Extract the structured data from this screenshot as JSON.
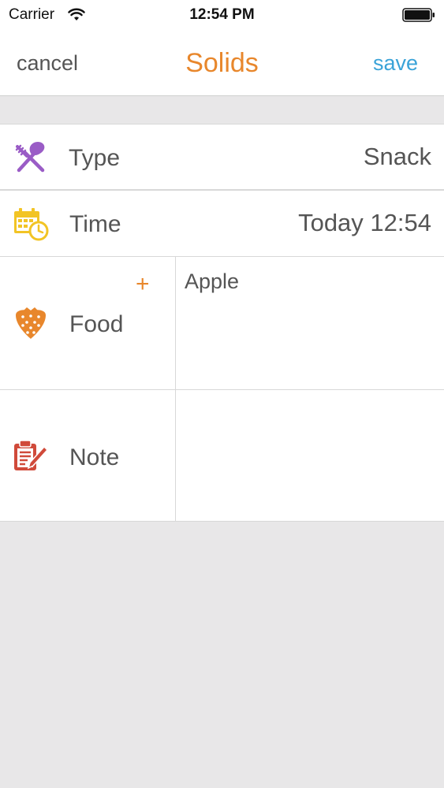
{
  "status_bar": {
    "carrier": "Carrier",
    "time": "12:54 PM"
  },
  "nav": {
    "cancel_label": "cancel",
    "title": "Solids",
    "save_label": "save"
  },
  "form": {
    "type": {
      "label": "Type",
      "value": "Snack",
      "icon": "fork-spoon-icon"
    },
    "time": {
      "label": "Time",
      "value": "Today 12:54",
      "icon": "calendar-clock-icon"
    },
    "food": {
      "label": "Food",
      "add_label": "+",
      "value": "Apple",
      "icon": "strawberry-icon"
    },
    "note": {
      "label": "Note",
      "value": "",
      "icon": "clipboard-pencil-icon"
    }
  },
  "colors": {
    "accent_orange": "#e8872c",
    "save_blue": "#3aa3d8",
    "type_purple": "#9a5cc6",
    "time_yellow": "#f2c425",
    "note_red": "#d04a3a",
    "background": "#e8e7e8"
  }
}
